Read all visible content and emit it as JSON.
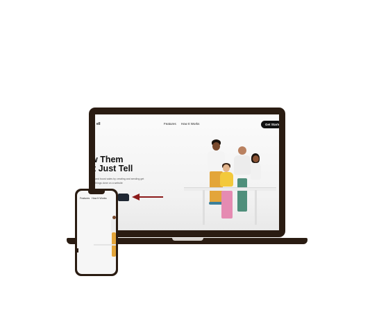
{
  "laptop_site": {
    "logo": "ell",
    "nav_links": [
      "Features",
      "How It Works"
    ],
    "cta": "Get Started",
    "hero_title_line1": "w Them",
    "hero_title_line2": "'t Just Tell",
    "hero_subtitle": "and boost sales by creating and sending get things done on a website"
  },
  "phone_site": {
    "nav_links": [
      "Features",
      "How It Works"
    ]
  },
  "colors": {
    "device_frame": "#2a1c12",
    "arrow": "#8b1a1a",
    "cta_background": "#111111"
  },
  "icons": {
    "arrow": "left-arrow-icon"
  }
}
